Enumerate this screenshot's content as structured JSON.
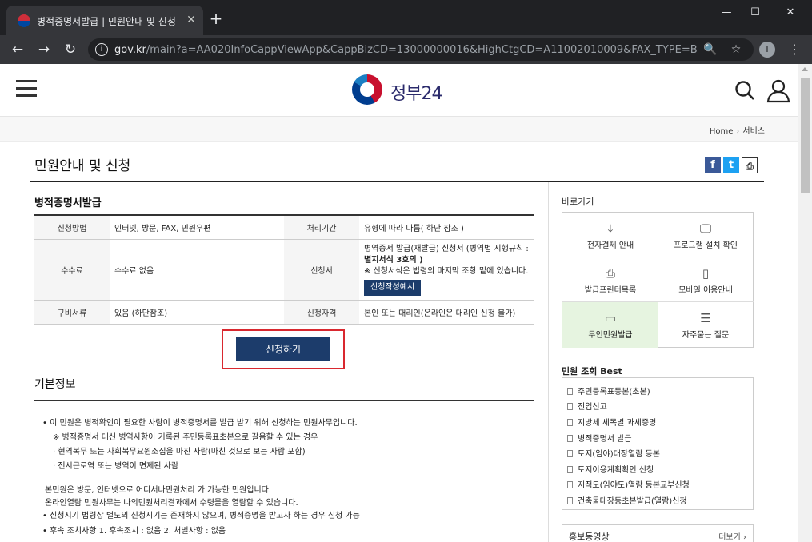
{
  "browser": {
    "tab_title": "병적증명서발급 | 민원안내 및 신청",
    "tab_close": "✕",
    "new_tab": "+",
    "url_host": "gov.kr",
    "url_path": "/main?a=AA020InfoCappViewApp&CappBizCD=13000000016&HighCtgCD=A11002010009&FAX_TYPE=B...",
    "profile_initial": "T",
    "window_min": "—",
    "window_max": "☐",
    "window_close": "✕"
  },
  "site": {
    "logo_text": "정부24",
    "breadcrumb": [
      "Home",
      "서비스"
    ]
  },
  "page": {
    "title": "민원안내 및 신청",
    "section_title": "병적증명서발급",
    "apply_label": "신청하기",
    "basic_title": "기본정보"
  },
  "info_table": {
    "method_label": "신청방법",
    "method_value": "인터넷, 방문, FAX, 민원우편",
    "period_label": "처리기간",
    "period_value": "유형에 따라 다름( 하단 참조 )",
    "fee_label": "수수료",
    "fee_value": "수수료 없음",
    "form_label": "신청서",
    "form_value_1": "병역증서 발급(재발급) 신청서 (병역법 시행규칙 :",
    "form_value_2": "별지서식 3호의 )",
    "form_value_3": "※ 신청서식은 법령의 마지막 조항 밑에 있습니다.",
    "form_button": "신청작성예시",
    "docs_label": "구비서류",
    "docs_value": "있음 (하단참조)",
    "qual_label": "신청자격",
    "qual_value": "본인 또는 대리인(온라인은 대리인 신청 불가)"
  },
  "basic_info": [
    "•  이 민원은 병적확인이 필요한 사람이 병적증명서를 발급 받기 위해 신청하는 민원사무입니다.",
    "※ 병적증명서 대신 병역사항이 기록된 주민등록표초본으로 갈음할 수 있는 경우",
    "· 현역복무 또는 사회복무요원소집을 마친 사람(마친 것으로 보는 사람 포함)",
    "· 전시근로역 또는 병역이 면제된 사람",
    "본민원은 방문, 인터넷으로 어디서나민원처리 가 가능한 민원입니다.",
    "온라인열람 민원사무는 나의민원처리결과에서 수령물을 열람할 수 있습니다.",
    "•  신청시기 법령상 별도의 신청시기는 존재하지 않으며, 병적증명을 받고자 하는 경우 신청 가능",
    "•  후속 조치사항 1. 후속조치 : 없음 2. 처벌사항 : 없음"
  ],
  "quick_links": {
    "title": "바로가기",
    "items": [
      {
        "label": "전자결제 안내",
        "icon": "download-icon"
      },
      {
        "label": "프로그램 설치 확인",
        "icon": "monitor-icon"
      },
      {
        "label": "발급프린터목록",
        "icon": "printer-icon"
      },
      {
        "label": "모바일 이용안내",
        "icon": "mobile-icon"
      },
      {
        "label": "무인민원발급",
        "icon": "kiosk-icon"
      },
      {
        "label": "자주묻는 질문",
        "icon": "chat-icon"
      }
    ]
  },
  "popular": {
    "title": "민원 조회 Best",
    "items": [
      "주민등록표등본(초본)",
      "전입신고",
      "지방세 세목별 과세증명",
      "병적증명서 발급",
      "토지(임야)대장열람 등본",
      "토지이용계획확인 신청",
      "지적도(임야도)열람 등본교부신청",
      "건축물대장등초본발급(열람)신청"
    ]
  },
  "video": {
    "title": "홍보동영상",
    "more": "더보기 ›"
  },
  "colors": {
    "navy_button": "#1c3c6b",
    "highlight_border": "#d9282f",
    "kiosk_highlight": "#e6f4e0"
  }
}
